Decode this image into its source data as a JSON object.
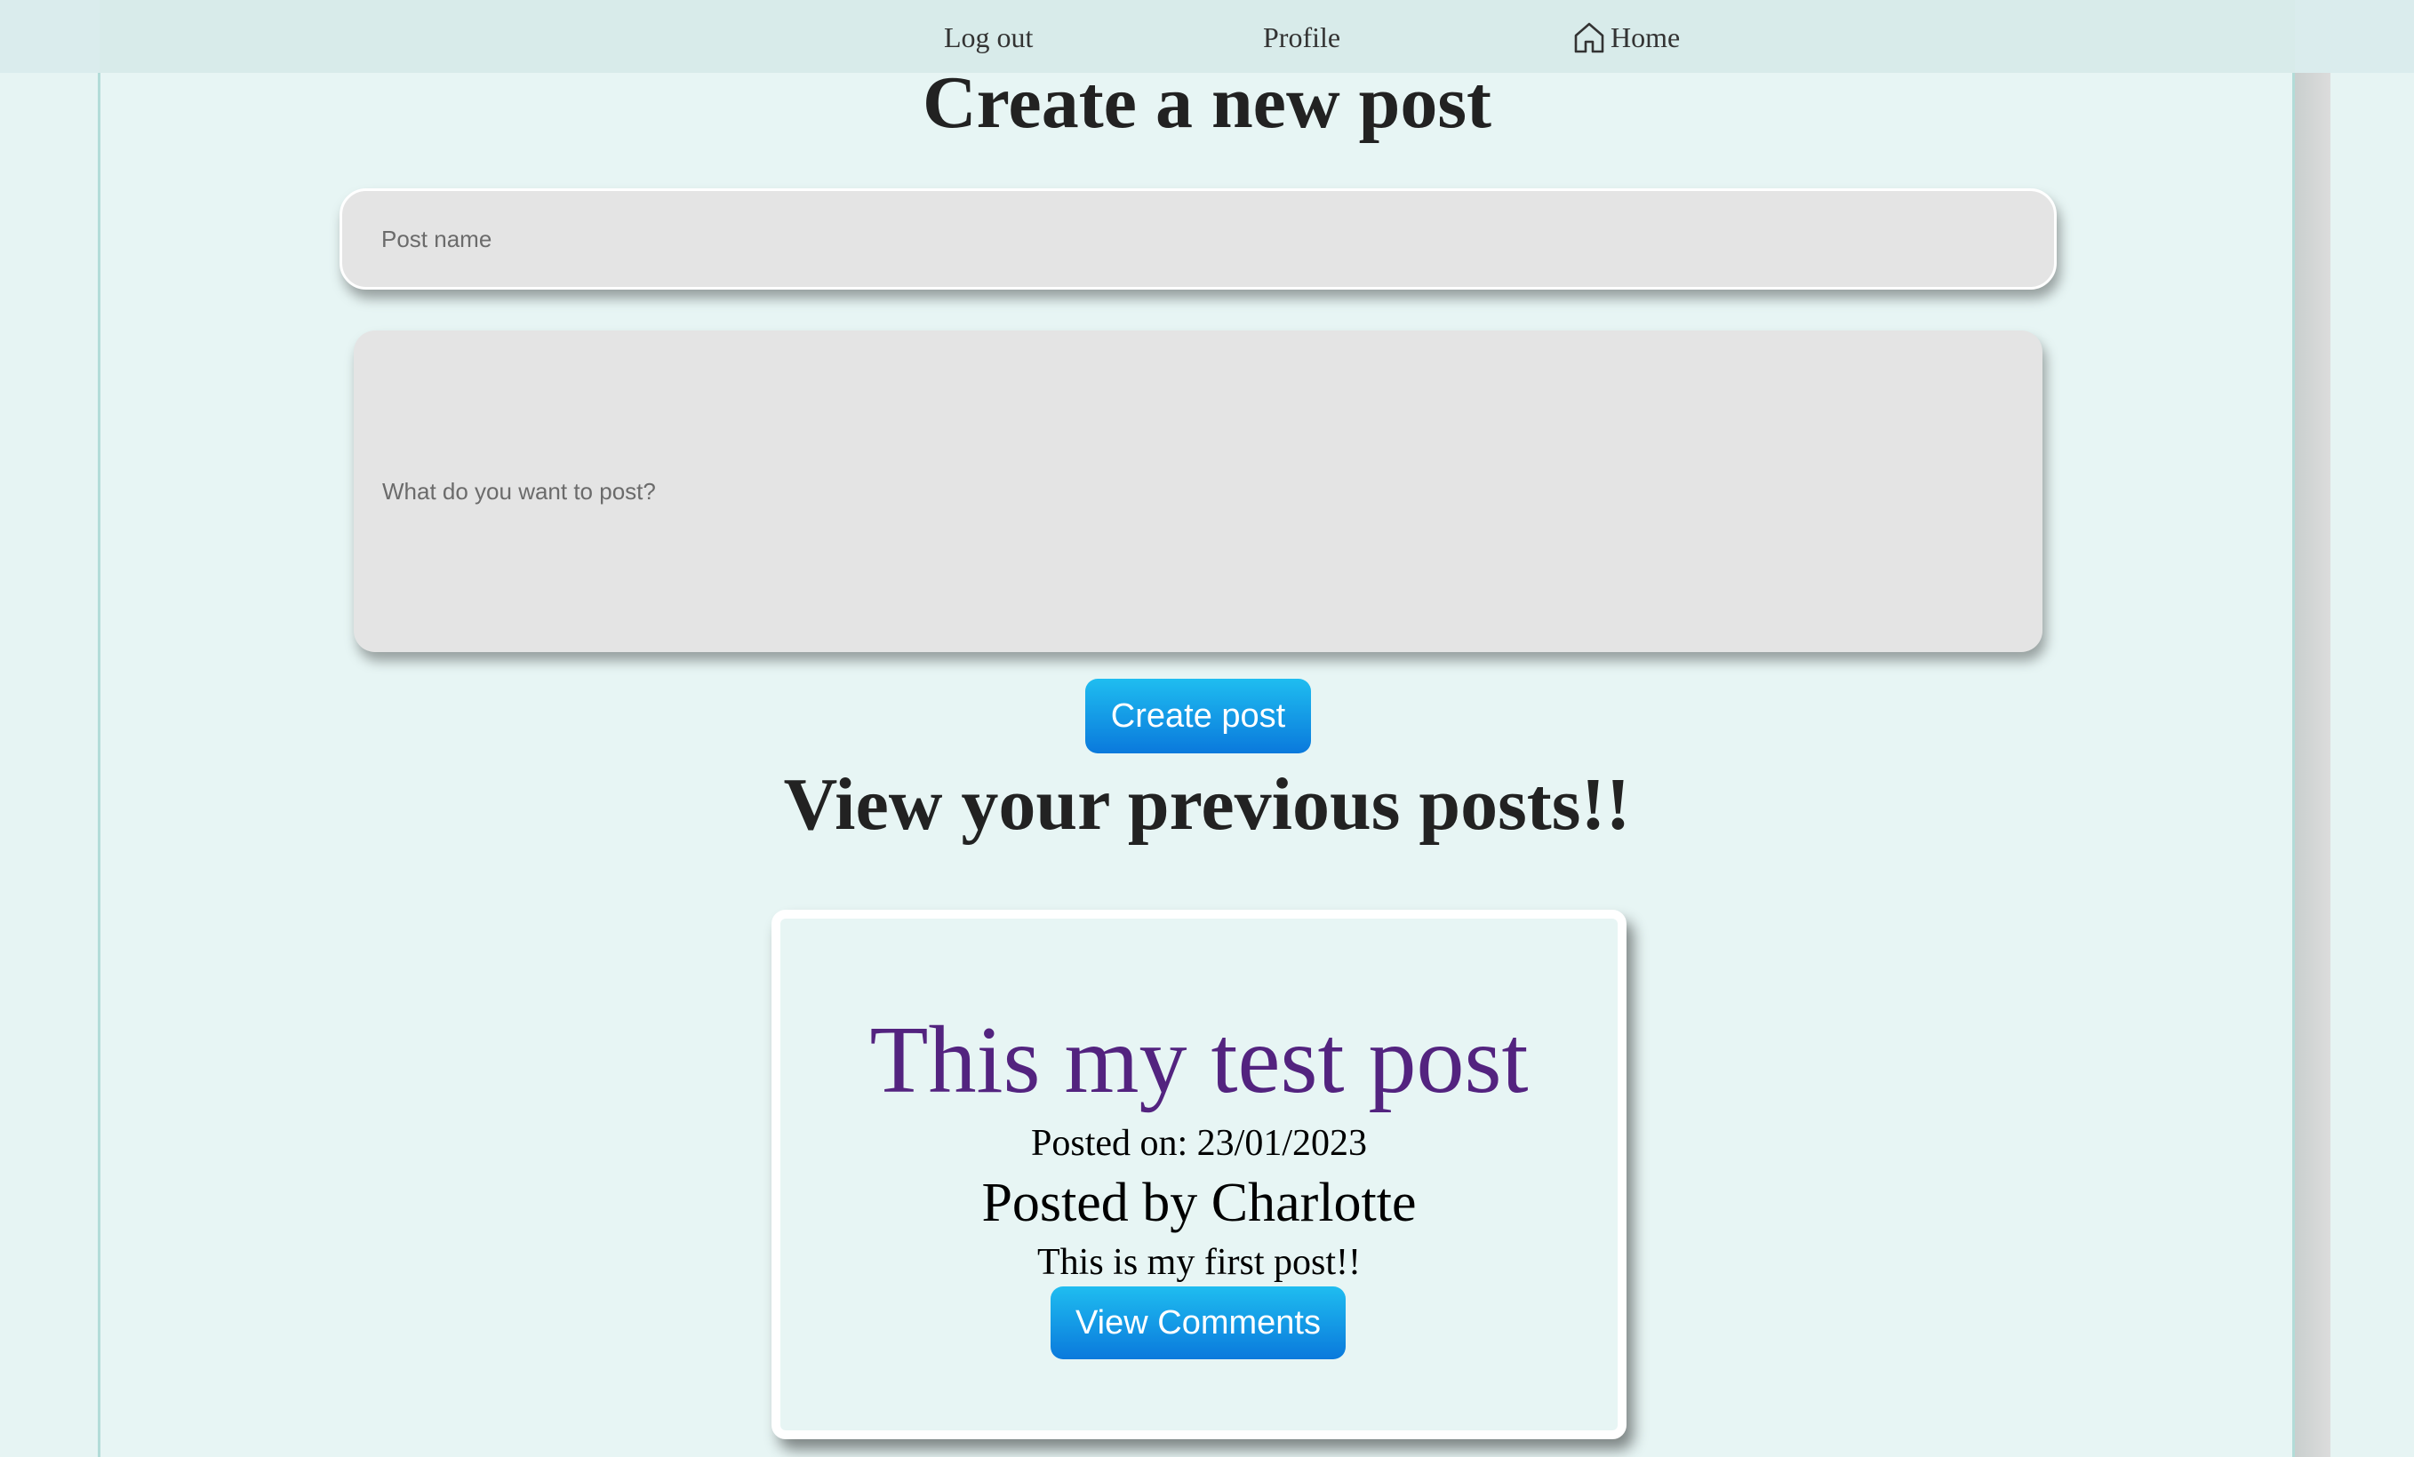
{
  "nav": {
    "logout_label": "Log out",
    "profile_label": "Profile",
    "home_label": "Home",
    "home_icon": "home-icon"
  },
  "create": {
    "heading": "Create a new post",
    "post_name_placeholder": "Post name",
    "post_body_placeholder": "What do you want to post?",
    "submit_label": "Create post"
  },
  "previous": {
    "heading": "View your previous posts!!",
    "posts": [
      {
        "title": "This my test post",
        "date": "Posted on: 23/01/2023",
        "author": "Posted by Charlotte",
        "content": "This is my first post!!",
        "comments_label": "View Comments"
      }
    ]
  },
  "colors": {
    "page_background": "#e6f4f3",
    "navbar_background": "#d8ebea",
    "button_gradient_top": "#1fbdf0",
    "button_gradient_bottom": "#0a79dc",
    "post_title": "#53237f",
    "input_background": "#e4e4e4"
  }
}
